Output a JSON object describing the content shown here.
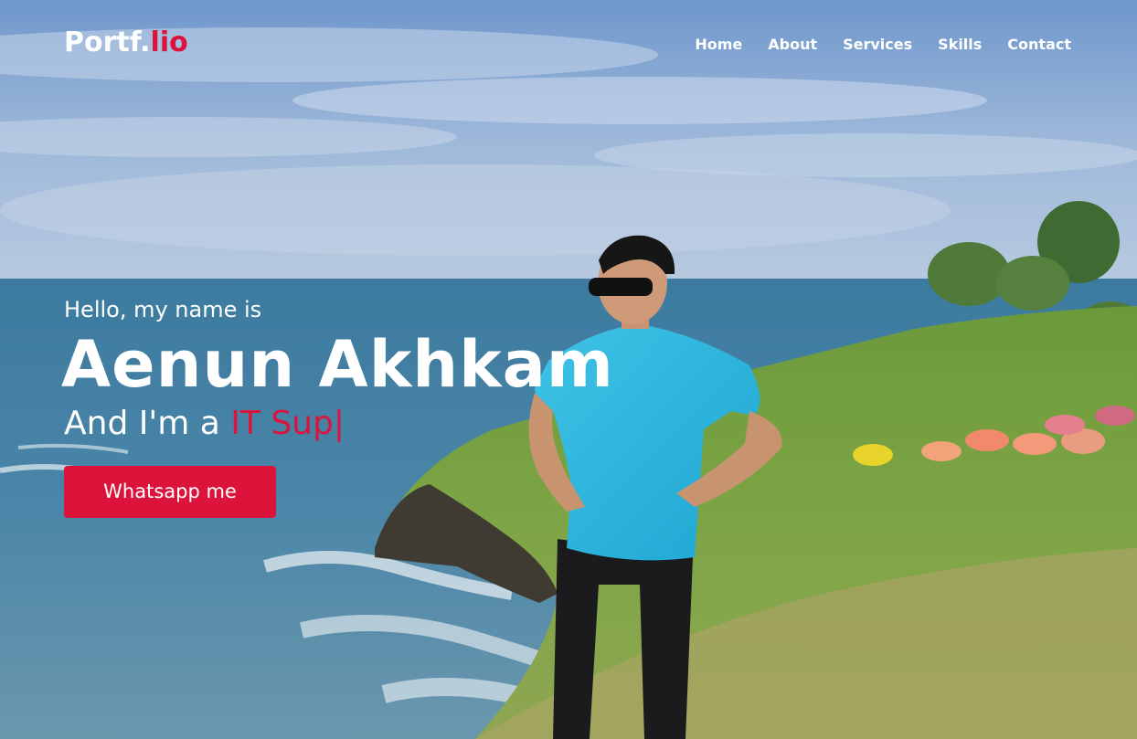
{
  "navbar": {
    "logo_prefix": "Portf.",
    "logo_accent": "lio",
    "menu": [
      {
        "label": "Home"
      },
      {
        "label": "About"
      },
      {
        "label": "Services"
      },
      {
        "label": "Skills"
      },
      {
        "label": "Contact"
      }
    ]
  },
  "hero": {
    "greeting": "Hello, my name is",
    "name": "Aenun Akhkam",
    "role_prefix": "And I'm a ",
    "role_typed": "IT Sup",
    "cursor": "|",
    "button_label": "Whatsapp me"
  },
  "colors": {
    "accent": "#dc143c",
    "text": "#ffffff"
  }
}
